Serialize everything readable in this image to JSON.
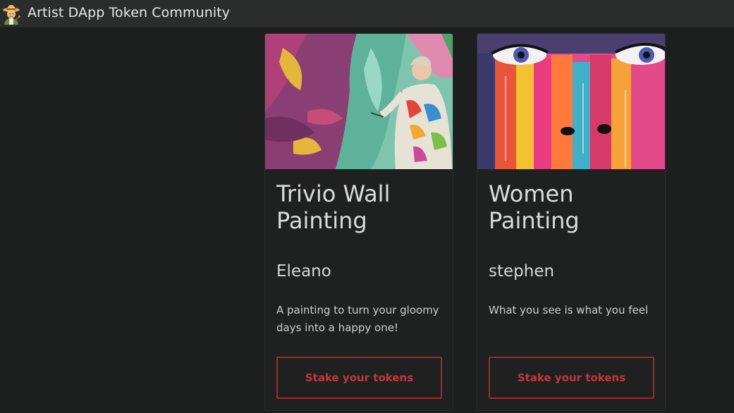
{
  "app": {
    "title": "Artist DApp Token Community",
    "logo_icon": "farmer-emoji-icon"
  },
  "cards": [
    {
      "title": "Trivio Wall Painting",
      "artist": "Eleano",
      "description": "A painting to turn your gloomy days into a happy one!",
      "button_label": "Stake your tokens",
      "image_subject": "artist-painting-mural-photo"
    },
    {
      "title": "Women Painting",
      "artist": "stephen",
      "description": "What you see is what you feel",
      "button_label": "Stake your tokens",
      "image_subject": "colorful-woman-face-painting"
    }
  ],
  "colors": {
    "background": "#1d1e1e",
    "navbar": "#2b2c2c",
    "card": "#1f2020",
    "accent_red": "#a5262a"
  }
}
